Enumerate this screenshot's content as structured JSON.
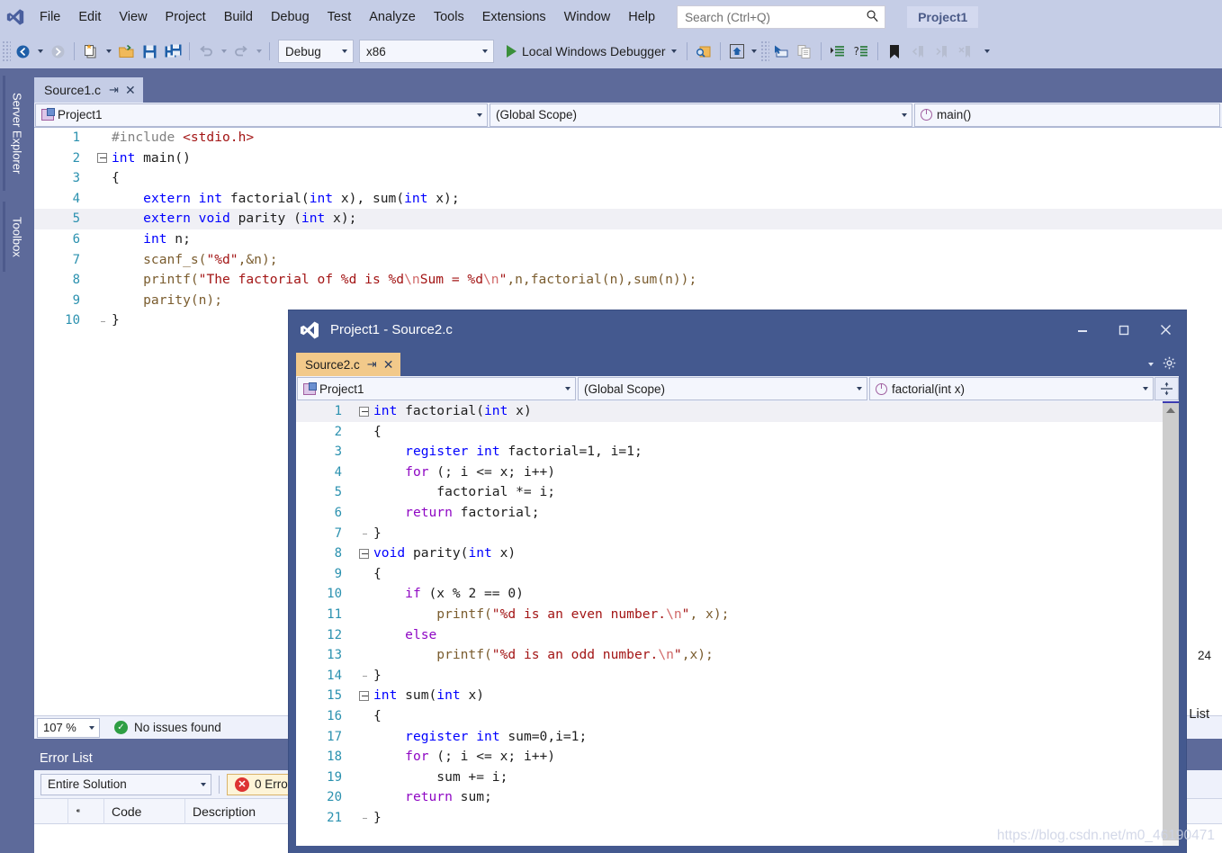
{
  "app": {
    "logo_icon": "visual-studio-logo-icon",
    "project_badge": "Project1"
  },
  "menu": {
    "items": [
      "File",
      "Edit",
      "View",
      "Project",
      "Build",
      "Debug",
      "Test",
      "Analyze",
      "Tools",
      "Extensions",
      "Window",
      "Help"
    ],
    "search_placeholder": "Search (Ctrl+Q)",
    "search_icon": "search-icon"
  },
  "toolbar": {
    "nav_back_icon": "navigate-back-icon",
    "nav_forward_icon": "navigate-forward-icon",
    "new_item_icon": "new-item-icon",
    "open_file_icon": "open-file-icon",
    "save_icon": "save-icon",
    "save_all_icon": "save-all-icon",
    "undo_icon": "undo-icon",
    "redo_icon": "redo-icon",
    "configuration": "Debug",
    "platform": "x86",
    "run_label": "Local Windows Debugger",
    "run_icon": "play-icon",
    "find_icon": "find-in-files-icon",
    "home_icon": "start-window-icon",
    "cursor_icon": "pointer-select-icon",
    "copy_icon": "copy-icon",
    "indent_icon": "increase-indent-icon",
    "comment_icon": "comment-icon",
    "bookmark_icon": "bookmark-icon",
    "prev_bookmark_icon": "previous-bookmark-icon",
    "next_bookmark_icon": "next-bookmark-icon",
    "clear_bookmark_icon": "clear-bookmarks-icon",
    "overflow_icon": "toolbar-overflow-icon"
  },
  "left_dock": {
    "tabs": [
      "Server Explorer",
      "Toolbox"
    ]
  },
  "main_document": {
    "tab_label": "Source1.c",
    "pin_icon": "pin-icon",
    "close_icon": "close-icon",
    "nav": {
      "project": "Project1",
      "project_icon": "project-icon",
      "scope": "(Global Scope)",
      "member": "main()",
      "member_icon": "method-icon"
    },
    "status": {
      "zoom": "107 %",
      "issues_icon": "check-circle-icon",
      "issues": "No issues found",
      "line_col": "24"
    },
    "code": [
      {
        "n": "1",
        "fold": "none",
        "rail": "none",
        "tokens": [
          {
            "t": "#include ",
            "c": "pd"
          },
          {
            "t": "<stdio.h>",
            "c": "p"
          }
        ]
      },
      {
        "n": "2",
        "fold": "box",
        "rail": "none",
        "tokens": [
          {
            "t": "int",
            "c": "k"
          },
          {
            "t": " main()",
            "c": "n"
          }
        ]
      },
      {
        "n": "3",
        "fold": "none",
        "rail": "solid",
        "tokens": [
          {
            "t": "{",
            "c": "n"
          }
        ]
      },
      {
        "n": "4",
        "fold": "none",
        "rail": "dash",
        "tokens": [
          {
            "t": "    ",
            "c": "n"
          },
          {
            "t": "extern",
            "c": "k"
          },
          {
            "t": " ",
            "c": "n"
          },
          {
            "t": "int",
            "c": "k"
          },
          {
            "t": " factorial(",
            "c": "n"
          },
          {
            "t": "int",
            "c": "k"
          },
          {
            "t": " x), sum(",
            "c": "n"
          },
          {
            "t": "int",
            "c": "k"
          },
          {
            "t": " x);",
            "c": "n"
          }
        ]
      },
      {
        "n": "5",
        "fold": "none",
        "rail": "dash",
        "hl": true,
        "tokens": [
          {
            "t": "    ",
            "c": "n"
          },
          {
            "t": "extern",
            "c": "k"
          },
          {
            "t": " ",
            "c": "n"
          },
          {
            "t": "void",
            "c": "k"
          },
          {
            "t": " parity (",
            "c": "n"
          },
          {
            "t": "int",
            "c": "k"
          },
          {
            "t": " x);",
            "c": "n"
          }
        ]
      },
      {
        "n": "6",
        "fold": "none",
        "rail": "dash",
        "tokens": [
          {
            "t": "    ",
            "c": "n"
          },
          {
            "t": "int",
            "c": "k"
          },
          {
            "t": " n;",
            "c": "n"
          }
        ]
      },
      {
        "n": "7",
        "fold": "none",
        "rail": "dash",
        "tokens": [
          {
            "t": "    scanf_s(",
            "c": "fn"
          },
          {
            "t": "\"%d\"",
            "c": "s"
          },
          {
            "t": ",&n);",
            "c": "fn"
          }
        ]
      },
      {
        "n": "8",
        "fold": "none",
        "rail": "dash",
        "tokens": [
          {
            "t": "    printf(",
            "c": "fn"
          },
          {
            "t": "\"The factorial of %d is %d",
            "c": "s"
          },
          {
            "t": "\\n",
            "c": "esc"
          },
          {
            "t": "Sum = %d",
            "c": "s"
          },
          {
            "t": "\\n",
            "c": "esc"
          },
          {
            "t": "\"",
            "c": "s"
          },
          {
            "t": ",n,factorial(n),sum(n));",
            "c": "fn"
          }
        ]
      },
      {
        "n": "9",
        "fold": "none",
        "rail": "dash",
        "tokens": [
          {
            "t": "    parity(n);",
            "c": "fn"
          }
        ]
      },
      {
        "n": "10",
        "fold": "none",
        "rail": "end",
        "tokens": [
          {
            "t": "}",
            "c": "n"
          }
        ]
      }
    ]
  },
  "error_list": {
    "title": "Error List",
    "scope_filter": "Entire Solution",
    "errors_badge": "0 Erro",
    "error_icon": "error-circle-icon",
    "columns": [
      "",
      "",
      "Code",
      "Description"
    ],
    "sort_icon": "sort-indicator-icon",
    "rows": []
  },
  "float_window": {
    "logo_icon": "visual-studio-logo-icon",
    "caption": "Project1 - Source2.c",
    "minimize_icon": "minimize-icon",
    "maximize_icon": "maximize-icon",
    "close_icon": "close-icon",
    "tab_label": "Source2.c",
    "pin_icon": "pin-icon",
    "tab_close_icon": "close-icon",
    "tab_menu_icon": "chevron-down-icon",
    "settings_icon": "gear-icon",
    "split_icon": "split-view-icon",
    "nav": {
      "project": "Project1",
      "project_icon": "project-icon",
      "scope": "(Global Scope)",
      "member": "factorial(int x)",
      "member_icon": "method-icon"
    },
    "code": [
      {
        "n": "1",
        "fold": "box",
        "rail": "none",
        "hl": true,
        "tokens": [
          {
            "t": "int",
            "c": "k"
          },
          {
            "t": " factorial(",
            "c": "n"
          },
          {
            "t": "int",
            "c": "k"
          },
          {
            "t": " x)",
            "c": "n"
          }
        ]
      },
      {
        "n": "2",
        "fold": "none",
        "rail": "solid",
        "tokens": [
          {
            "t": "{",
            "c": "n"
          }
        ]
      },
      {
        "n": "3",
        "fold": "none",
        "rail": "dash",
        "tokens": [
          {
            "t": "    ",
            "c": "n"
          },
          {
            "t": "register",
            "c": "k"
          },
          {
            "t": " ",
            "c": "n"
          },
          {
            "t": "int",
            "c": "k"
          },
          {
            "t": " factorial=1, i=1;",
            "c": "n"
          }
        ]
      },
      {
        "n": "4",
        "fold": "none",
        "rail": "dash",
        "tokens": [
          {
            "t": "    ",
            "c": "n"
          },
          {
            "t": "for",
            "c": "kc"
          },
          {
            "t": " (; i <= x; i++)",
            "c": "n"
          }
        ]
      },
      {
        "n": "5",
        "fold": "none",
        "rail": "dash",
        "tokens": [
          {
            "t": "        factorial *= i;",
            "c": "n"
          }
        ]
      },
      {
        "n": "6",
        "fold": "none",
        "rail": "dash",
        "tokens": [
          {
            "t": "    ",
            "c": "n"
          },
          {
            "t": "return",
            "c": "kc"
          },
          {
            "t": " factorial;",
            "c": "n"
          }
        ]
      },
      {
        "n": "7",
        "fold": "none",
        "rail": "end",
        "tokens": [
          {
            "t": "}",
            "c": "n"
          }
        ]
      },
      {
        "n": "8",
        "fold": "box",
        "rail": "none",
        "tokens": [
          {
            "t": "void",
            "c": "k"
          },
          {
            "t": " parity(",
            "c": "n"
          },
          {
            "t": "int",
            "c": "k"
          },
          {
            "t": " x)",
            "c": "n"
          }
        ]
      },
      {
        "n": "9",
        "fold": "none",
        "rail": "solid",
        "tokens": [
          {
            "t": "{",
            "c": "n"
          }
        ]
      },
      {
        "n": "10",
        "fold": "none",
        "rail": "dash",
        "tokens": [
          {
            "t": "    ",
            "c": "n"
          },
          {
            "t": "if",
            "c": "kc"
          },
          {
            "t": " (x % 2 == 0)",
            "c": "n"
          }
        ]
      },
      {
        "n": "11",
        "fold": "none",
        "rail": "dash",
        "tokens": [
          {
            "t": "        printf(",
            "c": "fn"
          },
          {
            "t": "\"%d is an even number.",
            "c": "s"
          },
          {
            "t": "\\n",
            "c": "esc"
          },
          {
            "t": "\"",
            "c": "s"
          },
          {
            "t": ", x);",
            "c": "fn"
          }
        ]
      },
      {
        "n": "12",
        "fold": "none",
        "rail": "dash",
        "tokens": [
          {
            "t": "    ",
            "c": "n"
          },
          {
            "t": "else",
            "c": "kc"
          }
        ]
      },
      {
        "n": "13",
        "fold": "none",
        "rail": "dash",
        "tokens": [
          {
            "t": "        printf(",
            "c": "fn"
          },
          {
            "t": "\"%d is an odd number.",
            "c": "s"
          },
          {
            "t": "\\n",
            "c": "esc"
          },
          {
            "t": "\"",
            "c": "s"
          },
          {
            "t": ",x);",
            "c": "fn"
          }
        ]
      },
      {
        "n": "14",
        "fold": "none",
        "rail": "end",
        "tokens": [
          {
            "t": "}",
            "c": "n"
          }
        ]
      },
      {
        "n": "15",
        "fold": "box",
        "rail": "none",
        "tokens": [
          {
            "t": "int",
            "c": "k"
          },
          {
            "t": " sum(",
            "c": "n"
          },
          {
            "t": "int",
            "c": "k"
          },
          {
            "t": " x)",
            "c": "n"
          }
        ]
      },
      {
        "n": "16",
        "fold": "none",
        "rail": "solid",
        "tokens": [
          {
            "t": "{",
            "c": "n"
          }
        ]
      },
      {
        "n": "17",
        "fold": "none",
        "rail": "dash",
        "tokens": [
          {
            "t": "    ",
            "c": "n"
          },
          {
            "t": "register",
            "c": "k"
          },
          {
            "t": " ",
            "c": "n"
          },
          {
            "t": "int",
            "c": "k"
          },
          {
            "t": " sum=0,i=1;",
            "c": "n"
          }
        ]
      },
      {
        "n": "18",
        "fold": "none",
        "rail": "dash",
        "tokens": [
          {
            "t": "    ",
            "c": "n"
          },
          {
            "t": "for",
            "c": "kc"
          },
          {
            "t": " (; i <= x; i++)",
            "c": "n"
          }
        ]
      },
      {
        "n": "19",
        "fold": "none",
        "rail": "dash",
        "tokens": [
          {
            "t": "        sum += i;",
            "c": "n"
          }
        ]
      },
      {
        "n": "20",
        "fold": "none",
        "rail": "dash",
        "tokens": [
          {
            "t": "    ",
            "c": "n"
          },
          {
            "t": "return",
            "c": "kc"
          },
          {
            "t": " sum;",
            "c": "n"
          }
        ]
      },
      {
        "n": "21",
        "fold": "none",
        "rail": "end",
        "tokens": [
          {
            "t": "}",
            "c": "n"
          }
        ]
      }
    ]
  },
  "background_remnants": {
    "line_col": "24",
    "partial_panel_label": "List"
  },
  "watermark": "https://blog.csdn.net/m0_46190471",
  "colors": {
    "chrome": "#c5cde6",
    "dock": "#5d6a9a",
    "float_title": "#44598f",
    "active_tab_float": "#f2c98a",
    "keyword": "#0000ff",
    "control_keyword": "#8f08c4",
    "string": "#a31515",
    "line_number": "#2b91af",
    "accent_green": "#2e9e44",
    "accent_red": "#d33333"
  }
}
